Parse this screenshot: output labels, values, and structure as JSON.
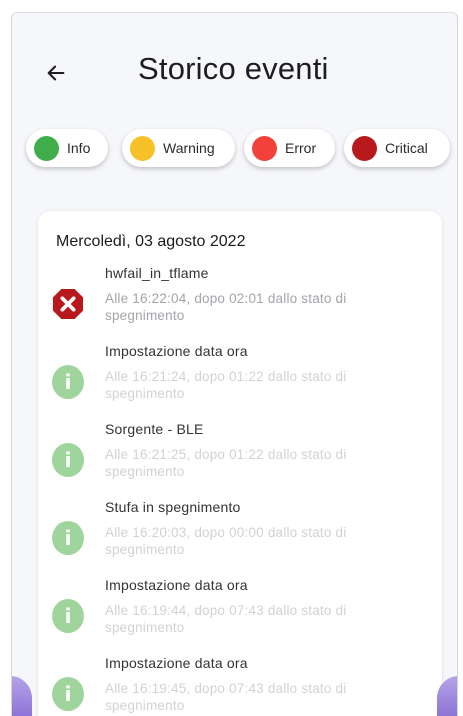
{
  "header": {
    "title": "Storico eventi",
    "back_icon": "arrow-left-icon"
  },
  "filters": [
    {
      "label": "Info",
      "color": "#3fae4a"
    },
    {
      "label": "Warning",
      "color": "#f7c12a"
    },
    {
      "label": "Error",
      "color": "#f2413a"
    },
    {
      "label": "Critical",
      "color": "#b8191d"
    }
  ],
  "day": {
    "date": "Mercoledì, 03 agosto 2022",
    "events": [
      {
        "type": "error",
        "icon": "error-octagon-icon",
        "title": "hwfail_in_tflame",
        "desc": "Alle 16:22:04, dopo 02:01 dallo stato di spegnimento"
      },
      {
        "type": "info",
        "icon": "info-icon",
        "title": "Impostazione data ora",
        "desc": "Alle 16:21:24, dopo 01:22 dallo stato di spegnimento"
      },
      {
        "type": "info",
        "icon": "info-icon",
        "title": "Sorgente - BLE",
        "desc": "Alle 16:21:25, dopo 01:22 dallo stato di spegnimento"
      },
      {
        "type": "info",
        "icon": "info-icon",
        "title": "Stufa in spegnimento",
        "desc": "Alle 16:20:03, dopo 00:00 dallo stato di spegnimento"
      },
      {
        "type": "info",
        "icon": "info-icon",
        "title": "Impostazione data ora",
        "desc": "Alle 16:19:44, dopo 07:43 dallo stato di spegnimento"
      },
      {
        "type": "info",
        "icon": "info-icon",
        "title": "Impostazione data ora",
        "desc": "Alle 16:19:45, dopo 07:43 dallo stato di spegnimento"
      }
    ]
  },
  "colors": {
    "info_icon_bg": "#9fd59c",
    "error_icon_bg": "#b8191d"
  }
}
